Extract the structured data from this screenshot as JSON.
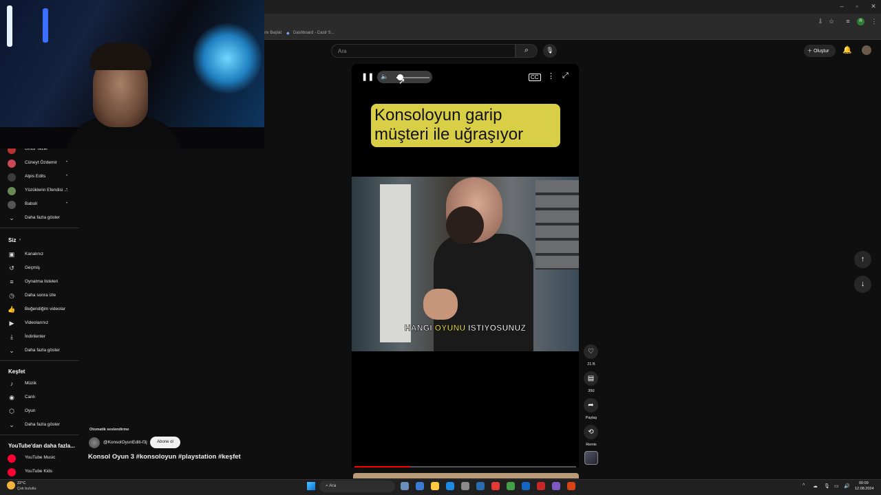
{
  "browser": {
    "bookmarks": [
      "ını Başlat",
      "Dashboard - Castr S..."
    ],
    "window_controls": {
      "minimize": "–",
      "maximize": "▫",
      "close": "✕"
    },
    "profile_letter": "R"
  },
  "header": {
    "search_placeholder": "Ara",
    "create_label": "Oluştur"
  },
  "sidebar": {
    "subscriptions": [
      {
        "label": "Ümür Tezel",
        "color": "#b8312f"
      },
      {
        "label": "Cüneyt Özdemir",
        "color": "#c94a55"
      },
      {
        "label": "Alpis Edits",
        "color": "#3c3c3c"
      },
      {
        "label": "Yüzüklerin Efendisi ...",
        "color": "#6a8a55"
      },
      {
        "label": "Baboli",
        "color": "#555555"
      }
    ],
    "show_more_1": "Daha fazla göster",
    "you_header": "Siz",
    "you_items": [
      {
        "label": "Kanalınız",
        "icon": "channel-icon"
      },
      {
        "label": "Geçmiş",
        "icon": "history-icon"
      },
      {
        "label": "Oynatma listeleri",
        "icon": "playlist-icon"
      },
      {
        "label": "Daha sonra izle",
        "icon": "clock-icon"
      },
      {
        "label": "Beğendiğim videolar",
        "icon": "thumb-up-icon"
      },
      {
        "label": "Videolarınız",
        "icon": "video-icon"
      },
      {
        "label": "İndirilenler",
        "icon": "download-icon"
      }
    ],
    "show_more_2": "Daha fazla göster",
    "explore_header": "Keşfet",
    "explore_items": [
      {
        "label": "Müzik",
        "icon": "music-icon"
      },
      {
        "label": "Canlı",
        "icon": "live-icon"
      },
      {
        "label": "Oyun",
        "icon": "gaming-icon"
      }
    ],
    "show_more_3": "Daha fazla göster",
    "more_header": "YouTube'dan daha fazla...",
    "more_items": [
      {
        "label": "YouTube Music",
        "color": "#ff0033"
      },
      {
        "label": "YouTube Kids",
        "color": "#ff0033"
      }
    ]
  },
  "player": {
    "caption_line1": "Konsoloyun garip",
    "caption_line2": "müşteri ile uğraşıyor",
    "subtitle_white1": "HANGI ",
    "subtitle_yellow": "OYUNU",
    "subtitle_white2": " ISTIYOSUNUZ",
    "volume_fraction": 0.1,
    "progress_fraction": 0.25
  },
  "actions": {
    "likes": "21 B",
    "comments": "350",
    "share": "Paylaş",
    "remix": "Remix"
  },
  "channel": {
    "auto_dub": "Otomatik seslendirme",
    "handle": "@KonsolOyunEditi-f3j",
    "subscribe": "Abone ol",
    "title": "Konsol Oyun 3 #konsoloyun #playstation #keşfet"
  },
  "taskbar": {
    "weather_temp": "22°C",
    "weather_desc": "Çok bulutlu",
    "search": "Ara",
    "time": "00:09",
    "date": "12.08.2024"
  },
  "colors": {
    "caption_bg": "#d9cf47",
    "progress": "#ff0000",
    "subtitle_highlight": "#f5e04a"
  }
}
